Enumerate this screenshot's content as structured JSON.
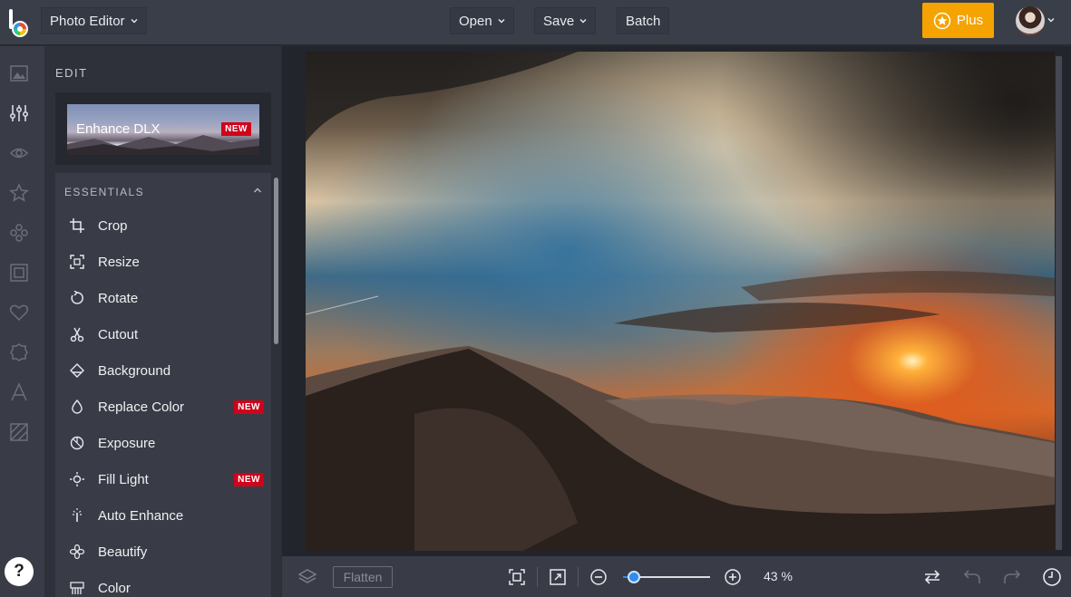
{
  "topbar": {
    "app_name": "Photo Editor",
    "open_label": "Open",
    "save_label": "Save",
    "batch_label": "Batch",
    "plus_label": "Plus"
  },
  "panel": {
    "section_title": "EDIT",
    "enhance_label": "Enhance DLX",
    "enhance_badge": "NEW",
    "essentials_title": "ESSENTIALS",
    "tools": [
      {
        "label": "Crop",
        "icon": "crop-icon"
      },
      {
        "label": "Resize",
        "icon": "resize-icon"
      },
      {
        "label": "Rotate",
        "icon": "rotate-icon"
      },
      {
        "label": "Cutout",
        "icon": "scissors-icon"
      },
      {
        "label": "Background",
        "icon": "eraser-icon"
      },
      {
        "label": "Replace Color",
        "icon": "droplet-icon",
        "badge": "NEW"
      },
      {
        "label": "Exposure",
        "icon": "exposure-icon"
      },
      {
        "label": "Fill Light",
        "icon": "sun-icon",
        "badge": "NEW"
      },
      {
        "label": "Auto Enhance",
        "icon": "magic-wand-icon"
      },
      {
        "label": "Beautify",
        "icon": "flower-icon"
      },
      {
        "label": "Color",
        "icon": "palette-icon"
      }
    ]
  },
  "rail": {
    "help_label": "?",
    "icons": [
      "image-icon",
      "sliders-icon",
      "eye-icon",
      "star-icon",
      "effects-icon",
      "frame-icon",
      "heart-icon",
      "badge-icon",
      "text-icon",
      "texture-icon"
    ]
  },
  "bottombar": {
    "flatten_label": "Flatten",
    "zoom_value": "43 %",
    "zoom_fraction": 0.12
  },
  "colors": {
    "accent": "#f5a300",
    "new_badge": "#d0021b",
    "slider": "#2f8cf0"
  }
}
